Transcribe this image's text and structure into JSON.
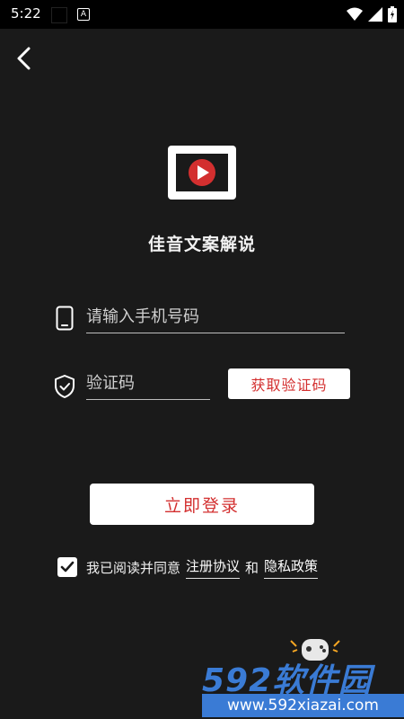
{
  "status_bar": {
    "time": "5:22",
    "notification_a": "A"
  },
  "app": {
    "name": "佳音文案解说"
  },
  "form": {
    "phone_placeholder": "请输入手机号码",
    "code_placeholder": "验证码",
    "get_code_label": "获取验证码",
    "login_label": "立即登录"
  },
  "agreement": {
    "checked": true,
    "prefix": "我已阅读并同意",
    "terms_link": "注册协议",
    "and": "和",
    "privacy_link": "隐私政策"
  },
  "watermark": {
    "brand": "592软件园",
    "url": "www.592xiazai.com"
  },
  "colors": {
    "background": "#1a1a1a",
    "accent": "#d32f2f",
    "button_bg": "#ffffff",
    "watermark_blue": "#3a7bd5"
  },
  "icons": [
    "back-arrow-icon",
    "play-logo-icon",
    "phone-icon",
    "shield-check-icon",
    "checkmark-icon",
    "wifi-icon",
    "signal-icon",
    "battery-icon"
  ]
}
